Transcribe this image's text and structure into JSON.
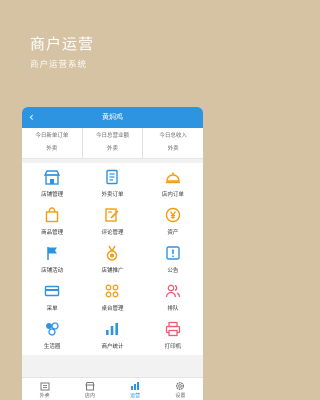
{
  "hero": {
    "title": "商户运营",
    "subtitle": "商户运营系统"
  },
  "header": {
    "back": "‹",
    "title": "黄焖鸡"
  },
  "stats": [
    {
      "label": "今日新单订单",
      "sub": "外卖"
    },
    {
      "label": "今日总营业额",
      "sub": "外卖"
    },
    {
      "label": "今日总收入",
      "sub": "外卖"
    }
  ],
  "grid": [
    {
      "label": "店铺管理",
      "icon": "shop-icon",
      "color": "#2d94e1"
    },
    {
      "label": "外卖订单",
      "icon": "order-list-icon",
      "color": "#2d94e1"
    },
    {
      "label": "店内订单",
      "icon": "dish-cover-icon",
      "color": "#f39c12"
    },
    {
      "label": "商品管理",
      "icon": "shopping-bag-icon",
      "color": "#f39c12"
    },
    {
      "label": "评论管理",
      "icon": "edit-icon",
      "color": "#f39c12"
    },
    {
      "label": "资产",
      "icon": "yen-icon",
      "color": "#f39c12"
    },
    {
      "label": "店铺活动",
      "icon": "flag-icon",
      "color": "#2d94e1"
    },
    {
      "label": "店铺推广",
      "icon": "medal-icon",
      "color": "#f39c12"
    },
    {
      "label": "公告",
      "icon": "notice-icon",
      "color": "#2d94e1"
    },
    {
      "label": "采单",
      "icon": "card-icon",
      "color": "#2d94e1"
    },
    {
      "label": "桌台管理",
      "icon": "table-icon",
      "color": "#f39c12"
    },
    {
      "label": "排队",
      "icon": "queue-icon",
      "color": "#f05b72"
    },
    {
      "label": "生活圈",
      "icon": "community-icon",
      "color": "#2d94e1"
    },
    {
      "label": "商户统计",
      "icon": "chart-icon",
      "color": "#2d94e1"
    },
    {
      "label": "打印机",
      "icon": "printer-icon",
      "color": "#f05b72"
    }
  ],
  "tabs": [
    {
      "label": "外卖",
      "icon": "takeout-icon",
      "active": false
    },
    {
      "label": "店内",
      "icon": "store-icon",
      "active": false
    },
    {
      "label": "运营",
      "icon": "operation-icon",
      "active": true
    },
    {
      "label": "设置",
      "icon": "settings-icon",
      "active": false
    }
  ]
}
